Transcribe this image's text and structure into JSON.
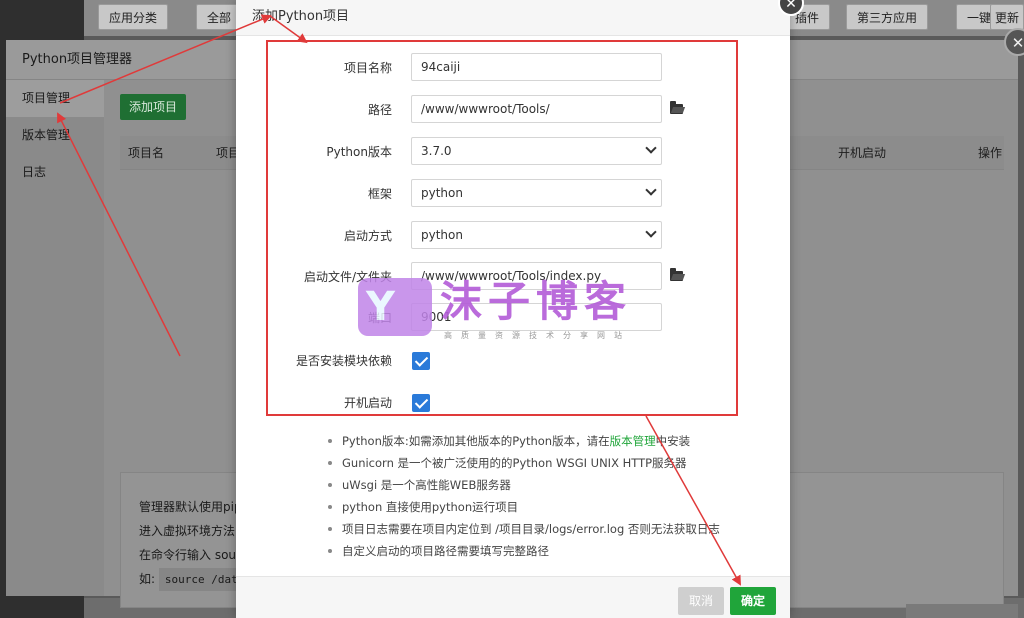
{
  "app_topbar": {
    "buttons": [
      "应用分类",
      "全部",
      "插件",
      "第三方应用",
      "一键部",
      "更新"
    ]
  },
  "manager": {
    "title": "Python项目管理器",
    "close_icon": "close-icon",
    "sidebar": [
      {
        "label": "项目管理",
        "active": true
      },
      {
        "label": "版本管理",
        "active": false
      },
      {
        "label": "日志",
        "active": false
      }
    ],
    "add_button": "添加项目",
    "table_headers": [
      "项目名",
      "项目",
      "开机启动",
      "操作"
    ],
    "help_lines": [
      "管理器默认使用pip",
      "进入虚拟环境方法:",
      "在命令行输入  sou",
      "如:"
    ],
    "help_code": "source /data"
  },
  "dialog": {
    "title": "添加Python项目",
    "fields": {
      "name": {
        "label": "项目名称",
        "value": "94caiji"
      },
      "path": {
        "label": "路径",
        "value": "/www/wwwroot/Tools/"
      },
      "python_version": {
        "label": "Python版本",
        "value": "3.7.0"
      },
      "framework": {
        "label": "框架",
        "value": "python"
      },
      "start_mode": {
        "label": "启动方式",
        "value": "python"
      },
      "start_file": {
        "label": "启动文件/文件夹",
        "value": "/www/wwwroot/Tools/index.py"
      },
      "port": {
        "label": "端口",
        "value": "9001"
      },
      "install_deps": {
        "label": "是否安装模块依赖",
        "checked": true
      },
      "autostart": {
        "label": "开机启动",
        "checked": true
      }
    },
    "tips": {
      "t1_before": "Python版本:如需添加其他版本的Python版本，请在",
      "t1_link": "版本管理",
      "t1_after": "中安装",
      "t2": "Gunicorn 是一个被广泛使用的的Python WSGI UNIX HTTP服务器",
      "t3": "uWsgi 是一个高性能WEB服务器",
      "t4": "python 直接使用python运行项目",
      "t5": "项目日志需要在项目内定位到 /项目目录/logs/error.log 否则无法获取日志",
      "t6": "自定义启动的项目路径需要填写完整路径"
    },
    "cancel": "取消",
    "confirm": "确定"
  },
  "watermark": {
    "logo_letter": "Y",
    "text": "沫子博客",
    "sub": "高质量资源技术分享网站"
  },
  "colors": {
    "accent_green": "#20a53a",
    "annotation_red": "#e03a3a",
    "checkbox_blue": "#2a7ad9"
  }
}
